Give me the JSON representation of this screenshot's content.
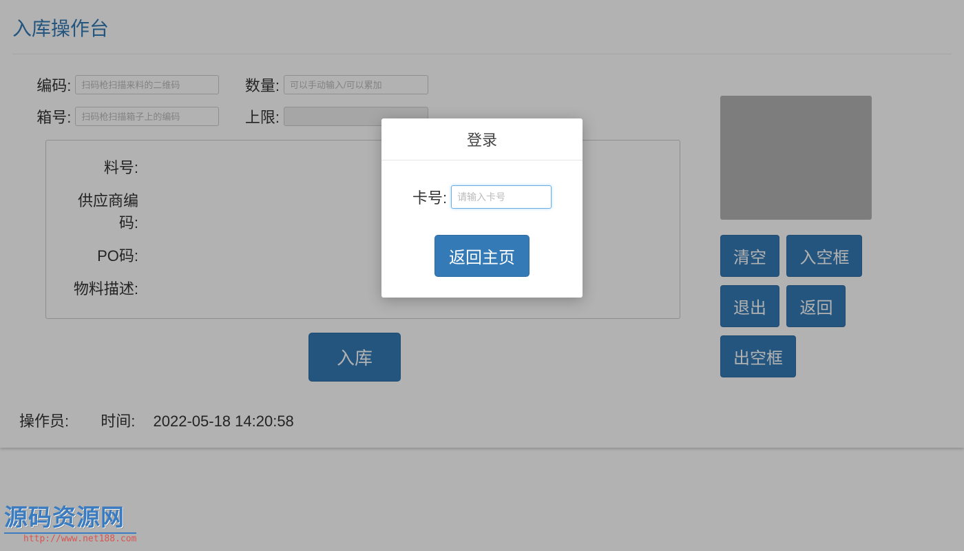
{
  "page": {
    "title": "入库操作台"
  },
  "form": {
    "code_label": "编码:",
    "code_placeholder": "扫码枪扫描来料的二维码",
    "qty_label": "数量:",
    "qty_placeholder": "可以手动输入/可以累加",
    "box_label": "箱号:",
    "box_placeholder": "扫码枪扫描箱子上的编码",
    "limit_label": "上限:",
    "limit_value": ""
  },
  "details": {
    "partno_label": "料号:",
    "partno_value": "",
    "supplier_label": "供应商编码:",
    "supplier_value": "",
    "po_label": "PO码:",
    "po_value": "",
    "desc_label": "物料描述:",
    "desc_value": ""
  },
  "actions": {
    "submit": "入库",
    "clear": "清空",
    "empty_in": "入空框",
    "logout": "退出",
    "back": "返回",
    "empty_out": "出空框"
  },
  "status": {
    "operator_label": "操作员:",
    "operator_value": "",
    "time_label": "时间:",
    "time_value": "2022-05-18 14:20:58"
  },
  "modal": {
    "title": "登录",
    "card_label": "卡号:",
    "card_placeholder": "请输入卡号",
    "return_btn": "返回主页"
  },
  "watermark": {
    "text": "源码资源网",
    "url": "http://www.net188.com"
  }
}
